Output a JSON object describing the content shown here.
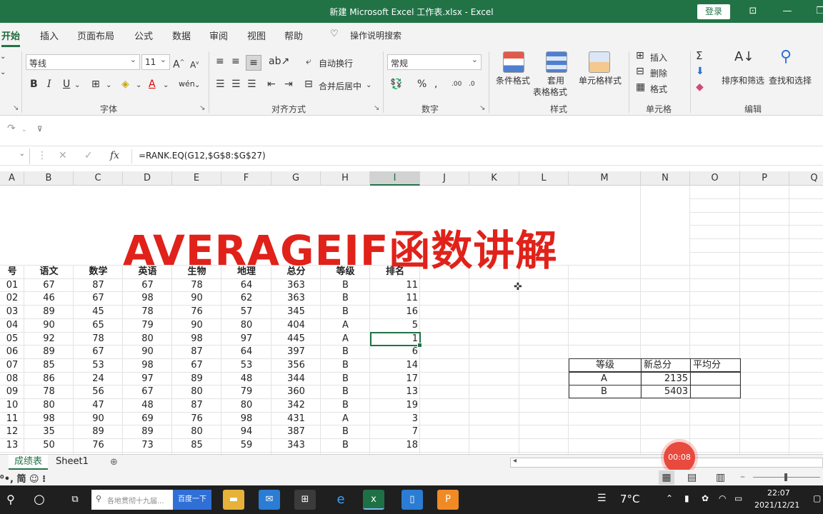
{
  "window": {
    "title": "新建 Microsoft Excel 工作表.xlsx  -  Excel",
    "login_label": "登录"
  },
  "tabs": [
    "开始",
    "插入",
    "页面布局",
    "公式",
    "数据",
    "审阅",
    "视图",
    "帮助"
  ],
  "tell_me": "操作说明搜索",
  "ribbon": {
    "font_name": "等线",
    "font_size": "11",
    "wrap_text": "自动换行",
    "merge_center": "合并后居中",
    "number_format": "常规",
    "conditional_format": "条件格式",
    "table_format_1": "套用",
    "table_format_2": "表格格式",
    "cell_styles": "单元格样式",
    "insert": "插入",
    "delete": "删除",
    "format": "格式",
    "sort_filter": "排序和筛选",
    "find_select": "查找和选择",
    "groups": {
      "font": "字体",
      "alignment": "对齐方式",
      "number": "数字",
      "styles": "样式",
      "cells": "单元格",
      "editing": "编辑"
    }
  },
  "formula_bar": {
    "fx": "fx",
    "formula": "=RANK.EQ(G12,$G$8:$G$27)"
  },
  "columns": [
    "A",
    "B",
    "C",
    "D",
    "E",
    "F",
    "G",
    "H",
    "I",
    "J",
    "K",
    "L",
    "M",
    "N",
    "O",
    "P",
    "Q"
  ],
  "sheet_title": "AVERAGEIF函数讲解",
  "table": {
    "headers": [
      "号",
      "语文",
      "数学",
      "英语",
      "生物",
      "地理",
      "总分",
      "等级",
      "排名"
    ],
    "rows": [
      [
        "01",
        "67",
        "87",
        "67",
        "78",
        "64",
        "363",
        "B",
        "11"
      ],
      [
        "02",
        "46",
        "67",
        "98",
        "90",
        "62",
        "363",
        "B",
        "11"
      ],
      [
        "03",
        "89",
        "45",
        "78",
        "76",
        "57",
        "345",
        "B",
        "16"
      ],
      [
        "04",
        "90",
        "65",
        "79",
        "90",
        "80",
        "404",
        "A",
        "5"
      ],
      [
        "05",
        "92",
        "78",
        "80",
        "98",
        "97",
        "445",
        "A",
        "1"
      ],
      [
        "06",
        "89",
        "67",
        "90",
        "87",
        "64",
        "397",
        "B",
        "6"
      ],
      [
        "07",
        "85",
        "53",
        "98",
        "67",
        "53",
        "356",
        "B",
        "14"
      ],
      [
        "08",
        "86",
        "24",
        "97",
        "89",
        "48",
        "344",
        "B",
        "17"
      ],
      [
        "09",
        "78",
        "56",
        "67",
        "80",
        "79",
        "360",
        "B",
        "13"
      ],
      [
        "10",
        "80",
        "47",
        "48",
        "87",
        "80",
        "342",
        "B",
        "19"
      ],
      [
        "11",
        "98",
        "90",
        "69",
        "76",
        "98",
        "431",
        "A",
        "3"
      ],
      [
        "12",
        "35",
        "89",
        "89",
        "80",
        "94",
        "387",
        "B",
        "7"
      ],
      [
        "13",
        "50",
        "76",
        "73",
        "85",
        "59",
        "343",
        "B",
        "18"
      ]
    ]
  },
  "summary": {
    "headers": [
      "等级",
      "新总分",
      "平均分"
    ],
    "rows": [
      [
        "A",
        "2135",
        ""
      ],
      [
        "B",
        "5403",
        ""
      ]
    ]
  },
  "sheets": [
    "成绩表",
    "Sheet1"
  ],
  "recording_timer": "00:08",
  "taskbar": {
    "search_placeholder": "各地贯彻十九届...",
    "search_button": "百度一下",
    "weather": "7°C",
    "time": "22:07",
    "date": "2021/12/21"
  },
  "colors": {
    "accent": "#217346",
    "title_red": "#e0221a"
  }
}
